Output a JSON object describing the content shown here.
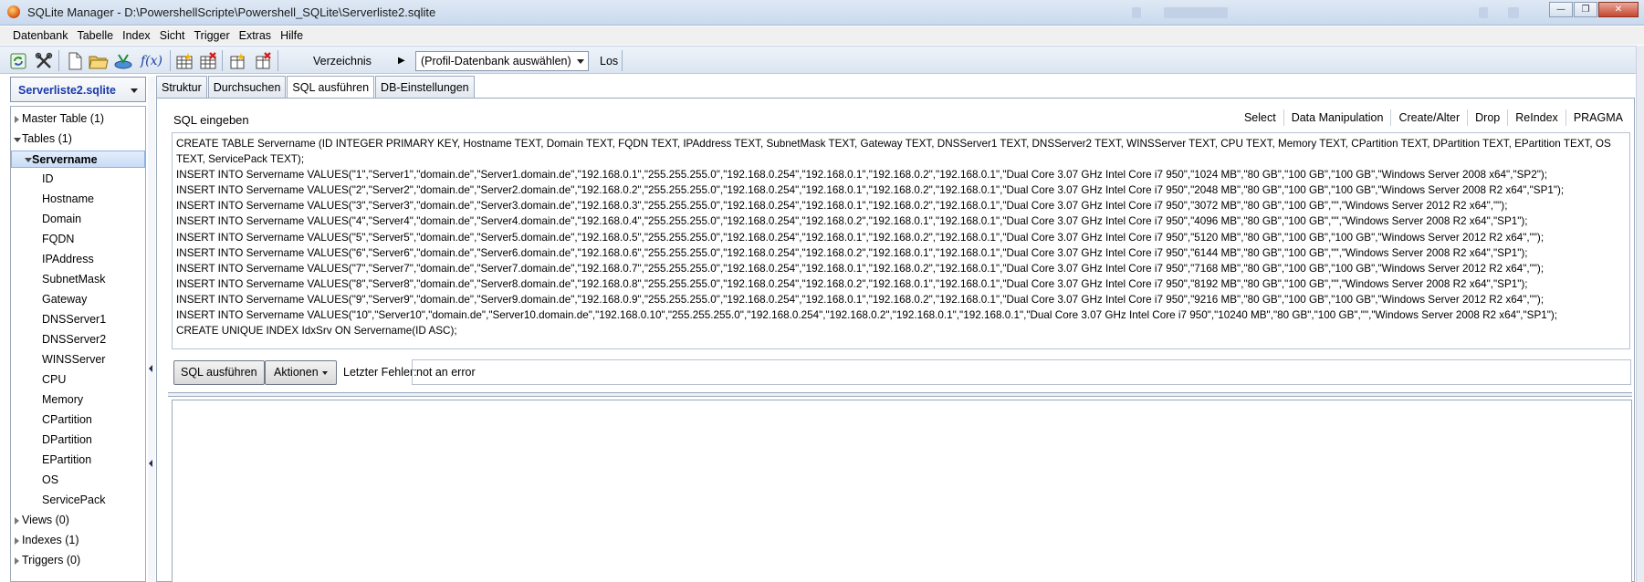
{
  "window": {
    "title": "SQLite Manager - D:\\PowershellScripte\\Powershell_SQLite\\Serverliste2.sqlite",
    "minimize_icon": "minimize-icon",
    "maximize_icon": "maximize-icon",
    "close_icon": "close-icon"
  },
  "menu": [
    "Datenbank",
    "Tabelle",
    "Index",
    "Sicht",
    "Trigger",
    "Extras",
    "Hilfe"
  ],
  "toolbar": {
    "directory_label": "Verzeichnis",
    "profile_select_value": "(Profil-Datenbank auswählen)",
    "go_label": "Los",
    "function_label": "f(x)"
  },
  "left_panel": {
    "database": "Serverliste2.sqlite",
    "tree": {
      "master_table": "Master Table (1)",
      "tables": "Tables (1)",
      "selected_table": "Servername",
      "columns": [
        "ID",
        "Hostname",
        "Domain",
        "FQDN",
        "IPAddress",
        "SubnetMask",
        "Gateway",
        "DNSServer1",
        "DNSServer2",
        "WINSServer",
        "CPU",
        "Memory",
        "CPartition",
        "DPartition",
        "EPartition",
        "OS",
        "ServicePack"
      ],
      "views": "Views (0)",
      "indexes": "Indexes (1)",
      "triggers": "Triggers (0)"
    }
  },
  "tabs": [
    "Struktur",
    "Durchsuchen",
    "SQL ausführen",
    "DB-Einstellungen"
  ],
  "active_tab": "SQL ausführen",
  "sql": {
    "label": "SQL eingeben",
    "toolbar": [
      "Select",
      "Data Manipulation",
      "Create/Alter",
      "Drop",
      "ReIndex",
      "PRAGMA"
    ],
    "lines": [
      "CREATE TABLE Servername (ID INTEGER PRIMARY KEY, Hostname TEXT, Domain TEXT, FQDN TEXT, IPAddress TEXT, SubnetMask TEXT, Gateway TEXT, DNSServer1 TEXT, DNSServer2 TEXT, WINSServer TEXT, CPU TEXT, Memory TEXT, CPartition TEXT, DPartition TEXT, EPartition TEXT, OS TEXT, ServicePack TEXT);",
      "INSERT INTO Servername VALUES(\"1\",\"Server1\",\"domain.de\",\"Server1.domain.de\",\"192.168.0.1\",\"255.255.255.0\",\"192.168.0.254\",\"192.168.0.1\",\"192.168.0.2\",\"192.168.0.1\",\"Dual Core 3.07 GHz Intel Core i7 950\",\"1024 MB\",\"80 GB\",\"100 GB\",\"100 GB\",\"Windows Server 2008 x64\",\"SP2\");",
      "INSERT INTO Servername VALUES(\"2\",\"Server2\",\"domain.de\",\"Server2.domain.de\",\"192.168.0.2\",\"255.255.255.0\",\"192.168.0.254\",\"192.168.0.1\",\"192.168.0.2\",\"192.168.0.1\",\"Dual Core 3.07 GHz Intel Core i7 950\",\"2048 MB\",\"80 GB\",\"100 GB\",\"100 GB\",\"Windows Server 2008 R2 x64\",\"SP1\");",
      "INSERT INTO Servername VALUES(\"3\",\"Server3\",\"domain.de\",\"Server3.domain.de\",\"192.168.0.3\",\"255.255.255.0\",\"192.168.0.254\",\"192.168.0.1\",\"192.168.0.2\",\"192.168.0.1\",\"Dual Core 3.07 GHz Intel Core i7 950\",\"3072 MB\",\"80 GB\",\"100 GB\",\"\",\"Windows Server 2012 R2 x64\",\"\");",
      "INSERT INTO Servername VALUES(\"4\",\"Server4\",\"domain.de\",\"Server4.domain.de\",\"192.168.0.4\",\"255.255.255.0\",\"192.168.0.254\",\"192.168.0.2\",\"192.168.0.1\",\"192.168.0.1\",\"Dual Core 3.07 GHz Intel Core i7 950\",\"4096 MB\",\"80 GB\",\"100 GB\",\"\",\"Windows Server 2008 R2 x64\",\"SP1\");",
      "INSERT INTO Servername VALUES(\"5\",\"Server5\",\"domain.de\",\"Server5.domain.de\",\"192.168.0.5\",\"255.255.255.0\",\"192.168.0.254\",\"192.168.0.1\",\"192.168.0.2\",\"192.168.0.1\",\"Dual Core 3.07 GHz Intel Core i7 950\",\"5120 MB\",\"80 GB\",\"100 GB\",\"100 GB\",\"Windows Server 2012 R2 x64\",\"\");",
      "INSERT INTO Servername VALUES(\"6\",\"Server6\",\"domain.de\",\"Server6.domain.de\",\"192.168.0.6\",\"255.255.255.0\",\"192.168.0.254\",\"192.168.0.2\",\"192.168.0.1\",\"192.168.0.1\",\"Dual Core 3.07 GHz Intel Core i7 950\",\"6144 MB\",\"80 GB\",\"100 GB\",\"\",\"Windows Server 2008 R2 x64\",\"SP1\");",
      "INSERT INTO Servername VALUES(\"7\",\"Server7\",\"domain.de\",\"Server7.domain.de\",\"192.168.0.7\",\"255.255.255.0\",\"192.168.0.254\",\"192.168.0.1\",\"192.168.0.2\",\"192.168.0.1\",\"Dual Core 3.07 GHz Intel Core i7 950\",\"7168 MB\",\"80 GB\",\"100 GB\",\"100 GB\",\"Windows Server 2012 R2 x64\",\"\");",
      "INSERT INTO Servername VALUES(\"8\",\"Server8\",\"domain.de\",\"Server8.domain.de\",\"192.168.0.8\",\"255.255.255.0\",\"192.168.0.254\",\"192.168.0.2\",\"192.168.0.1\",\"192.168.0.1\",\"Dual Core 3.07 GHz Intel Core i7 950\",\"8192 MB\",\"80 GB\",\"100 GB\",\"\",\"Windows Server 2008 R2 x64\",\"SP1\");",
      "INSERT INTO Servername VALUES(\"9\",\"Server9\",\"domain.de\",\"Server9.domain.de\",\"192.168.0.9\",\"255.255.255.0\",\"192.168.0.254\",\"192.168.0.1\",\"192.168.0.2\",\"192.168.0.1\",\"Dual Core 3.07 GHz Intel Core i7 950\",\"9216 MB\",\"80 GB\",\"100 GB\",\"100 GB\",\"Windows Server 2012 R2 x64\",\"\");",
      "INSERT INTO Servername VALUES(\"10\",\"Server10\",\"domain.de\",\"Server10.domain.de\",\"192.168.0.10\",\"255.255.255.0\",\"192.168.0.254\",\"192.168.0.2\",\"192.168.0.1\",\"192.168.0.1\",\"Dual Core 3.07 GHz Intel Core i7 950\",\"10240 MB\",\"80 GB\",\"100 GB\",\"\",\"Windows Server 2008 R2 x64\",\"SP1\");",
      "CREATE UNIQUE INDEX IdxSrv ON Servername(ID ASC);"
    ],
    "run_button": "SQL ausführen",
    "actions_button": "Aktionen",
    "last_error_label": "Letzter Fehler:",
    "last_error_value": "not an error"
  },
  "colors": {
    "db_name": "#1a3aa8",
    "selection": "#c8dcf6",
    "titlebar": "#c9d9ee"
  }
}
